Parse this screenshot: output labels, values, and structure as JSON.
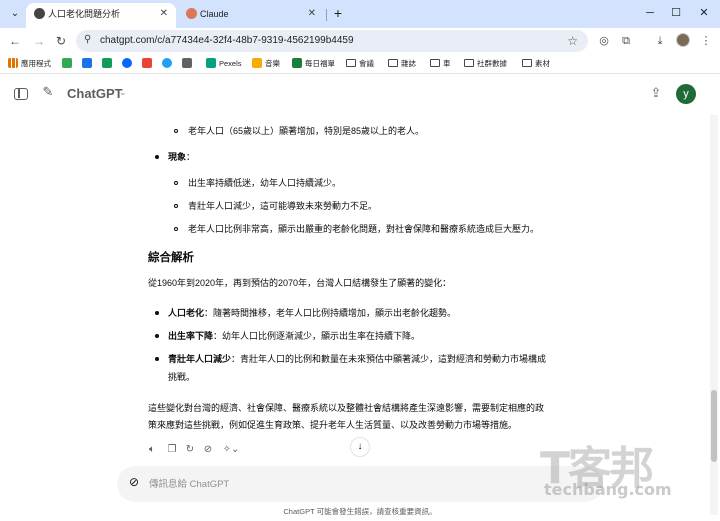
{
  "browser": {
    "tabs": [
      {
        "title": "人口老化問題分析",
        "active": true
      },
      {
        "title": "Claude",
        "active": false
      }
    ],
    "url": "chatgpt.com/c/a77434e4-32f4-48b7-9319-4562199b4459",
    "bookmarks": [
      "應用程式",
      "Pexels",
      "音樂",
      "每日福單",
      "會議",
      "雜誌",
      "車",
      "社群數據",
      "素材"
    ]
  },
  "app": {
    "model_name": "ChatGPT",
    "avatar_letter": "y"
  },
  "response": {
    "sub_top": "老年人口（65歲以上）顯著增加，特別是85歲以上的老人。",
    "phenomenon_label": "現象",
    "phenomenon_colon": "：",
    "phenomenon_items": [
      "出生率持續低迷，幼年人口持續減少。",
      "青壯年人口減少，這可能導致未來勞動力不足。",
      "老年人口比例非常高，顯示出嚴重的老齡化問題，對社會保障和醫療系統造成巨大壓力。"
    ],
    "analysis_heading": "綜合解析",
    "analysis_intro": "從1960年到2020年，再到預估的2070年，台灣人口結構發生了顯著的變化：",
    "analysis_points": [
      {
        "label": "人口老化",
        "text": "：隨著時間推移，老年人口比例持續增加，顯示出老齡化趨勢。"
      },
      {
        "label": "出生率下降",
        "text": "：幼年人口比例逐漸減少，顯示出生率在持續下降。"
      },
      {
        "label": "青壯年人口減少",
        "text": "：青壯年人口的比例和數量在未來預估中顯著減少，這對經濟和勞動力市場構成",
        "text2": "挑戰。"
      }
    ],
    "conclusion_line1": "這些變化對台灣的經濟、社會保障、醫療系統以及整體社會結構將產生深遠影響，需要制定相應的政",
    "conclusion_line2": "策來應對這些挑戰，例如促進生育政策、提升老年人生活質量、以及改善勞動力市場等措施。"
  },
  "composer": {
    "placeholder": "傳訊息給 ChatGPT"
  },
  "footer": {
    "disclaimer": "ChatGPT 可能會發生錯誤，請查核重要資訊。"
  },
  "watermark": {
    "big": "T客邦",
    "small": "techbang.com"
  },
  "colors": {
    "tab_strip": "#d3e3fd",
    "avatar": "#1e6b37",
    "composer_bg": "#f4f4f4"
  }
}
